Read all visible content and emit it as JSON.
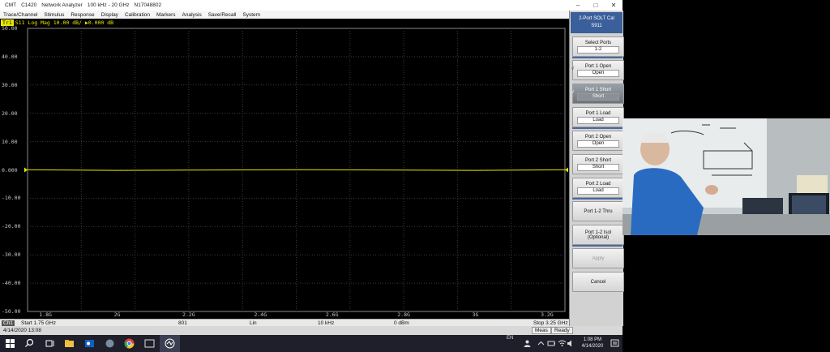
{
  "window": {
    "app_name": "CMT",
    "model": "C1420",
    "product": "Network Analyzer",
    "freq_range": "100 kHz - 20 GHz",
    "serial": "N17048802",
    "controls": [
      "–",
      "□",
      "✕"
    ]
  },
  "menu": [
    "Trace/Channel",
    "Stimulus",
    "Response",
    "Display",
    "Calibration",
    "Markers",
    "Analysis",
    "Save/Recall",
    "System"
  ],
  "trace_header": {
    "badge": "Tr1",
    "text": "S11 Log Mag 10.00 dB/ ▶0.000 dB"
  },
  "chart_data": {
    "type": "line",
    "series": [
      {
        "name": "",
        "x": [
          1.75,
          2.0,
          2.5,
          3.0,
          3.25
        ],
        "values": [
          0.0,
          0.0,
          0.0,
          0.0,
          0.0
        ]
      }
    ],
    "ylabels": [
      "50.00",
      "40.00",
      "30.00",
      "20.00",
      "10.00",
      "0.000",
      "-10.00",
      "-20.00",
      "-30.00",
      "-40.00",
      "-50.00"
    ],
    "xlabels": [
      "1.8G",
      "2G",
      "2.2G",
      "2.4G",
      "2.6G",
      "2.8G",
      "3G",
      "3.2G"
    ],
    "xlim": [
      1.75,
      3.25
    ],
    "ylim": [
      -50,
      50
    ],
    "grid": true,
    "colors": {
      "trace": "#e8e800",
      "grid": "#3a3a3a",
      "background": "#000000"
    }
  },
  "status": {
    "channel_badge": "Ch1",
    "start": "Start 1.75 GHz",
    "points": "801",
    "sweep_type": "Lin",
    "ifbw": "10 kHz",
    "power": "0 dBm",
    "stop": "Stop 3.25 GHz",
    "datetime": "4/14/2020 13:08",
    "meas": "Meas",
    "ready": "Ready"
  },
  "panel": {
    "title_line1": "2-Port SOLT Cal",
    "title_line2": "S911",
    "keys": [
      {
        "label": "Select Ports",
        "value": "1-2"
      },
      {
        "label": "Port 1 Open",
        "value": "Open"
      },
      {
        "label": "Port 1 Short",
        "value": "Short"
      },
      {
        "label": "Port 1 Load",
        "value": "Load"
      },
      {
        "label": "Port 2 Open",
        "value": "Open"
      },
      {
        "label": "Port 2 Short",
        "value": "Short"
      },
      {
        "label": "Port 2 Load",
        "value": "Load"
      },
      {
        "label": "Port 1-2 Thru"
      },
      {
        "label": "Port 1-2 Isol",
        "value": "(Optional)"
      },
      {
        "label": "Apply"
      },
      {
        "label": "Cancel"
      }
    ],
    "check_mark": "√"
  },
  "taskbar": {
    "lang": "EN",
    "time": "1:08 PM",
    "date": "4/14/2020"
  }
}
